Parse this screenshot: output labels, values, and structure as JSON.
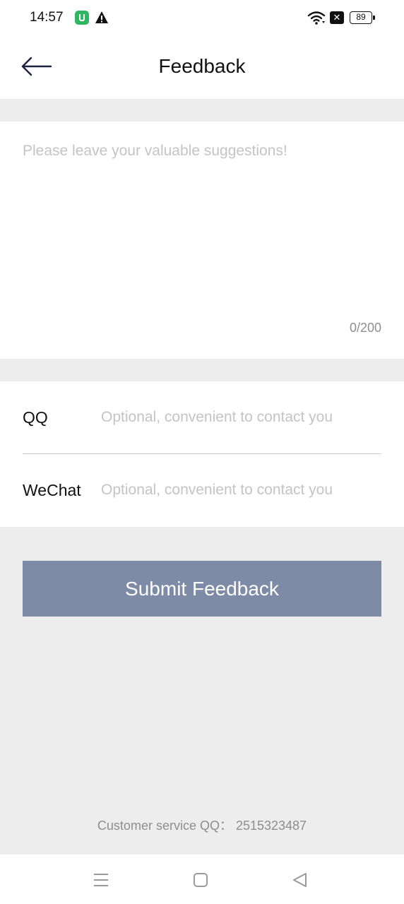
{
  "status_bar": {
    "time": "14:57",
    "battery": "89",
    "icons": [
      "app-notification-icon",
      "warning-icon",
      "wifi-icon",
      "no-sim-icon",
      "battery-icon"
    ]
  },
  "header": {
    "back_icon": "arrow-left-icon",
    "title": "Feedback"
  },
  "suggestion": {
    "value": "",
    "placeholder": "Please leave your valuable suggestions!",
    "counter": "0/200"
  },
  "contact": {
    "qq": {
      "label": "QQ",
      "value": "",
      "placeholder": "Optional, convenient to contact you"
    },
    "wechat": {
      "label": "WeChat",
      "value": "",
      "placeholder": "Optional, convenient to contact you"
    }
  },
  "submit": {
    "label": "Submit Feedback"
  },
  "customer_service": {
    "text": "Customer service QQ：  2515323487"
  },
  "colors": {
    "background": "#ededed",
    "card": "#ffffff",
    "button": "#7d8ba6",
    "placeholder": "#c4c4c4",
    "secondary_text": "#8e8e8e"
  },
  "nav_bar": {
    "icons": [
      "menu-icon",
      "home-icon",
      "back-triangle-icon"
    ]
  }
}
